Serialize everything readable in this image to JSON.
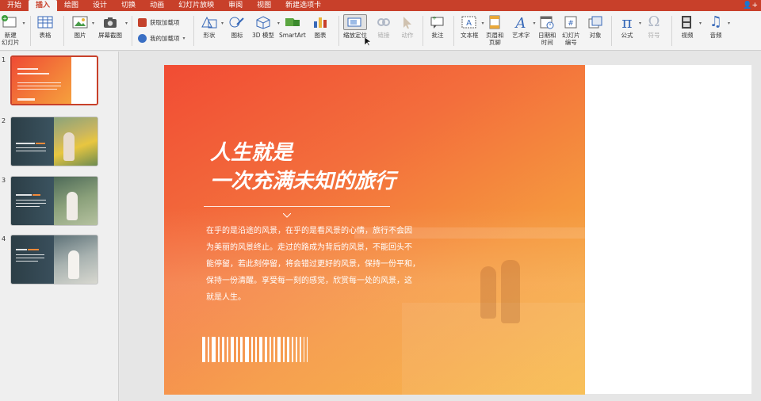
{
  "menu": {
    "items": [
      "开始",
      "插入",
      "绘图",
      "设计",
      "切换",
      "动画",
      "幻灯片放映",
      "审阅",
      "视图",
      "新建选项卡"
    ],
    "active": "插入"
  },
  "ribbon": {
    "new_slide": "新建\n幻灯片",
    "table": "表格",
    "picture": "图片",
    "screenshot": "屏幕截图",
    "get_addins": "获取加载项",
    "my_addins": "我的加载项",
    "shapes": "形状",
    "icons": "图标",
    "model3d": "3D 模型",
    "smartart": "SmartArt",
    "chart": "图表",
    "zoom": "缩放定位",
    "link": "链接",
    "action": "动作",
    "comment": "批注",
    "textbox": "文本框",
    "header_footer": "页眉和\n页脚",
    "wordart": "艺术字",
    "datetime": "日期和\n时间",
    "slide_number": "幻灯片\n编号",
    "object": "对象",
    "equation": "公式",
    "symbol": "符号",
    "video": "视频",
    "audio": "音频"
  },
  "thumbnails": {
    "numbers": [
      "1",
      "2",
      "3",
      "4"
    ],
    "selected": 1
  },
  "slide": {
    "title_line1": "人生就是",
    "title_line2": "一次充满未知的旅行",
    "body_lines": [
      "在乎的是沿途的风景，在乎的是看风景的心情，旅行不会因",
      "为美丽的风景终止。走过的路成为背后的风景，不能回头不",
      "能停留，若此刻停留，将会错过更好的风景，保持一份平和，",
      "保持一份清醒。享受每一刻的感觉，欣赏每一处的风景，这",
      "就是人生。"
    ]
  },
  "colors": {
    "accent": "#c8402a",
    "slide_gradient_start": "#f14c34",
    "slide_gradient_end": "#f7b73f"
  }
}
